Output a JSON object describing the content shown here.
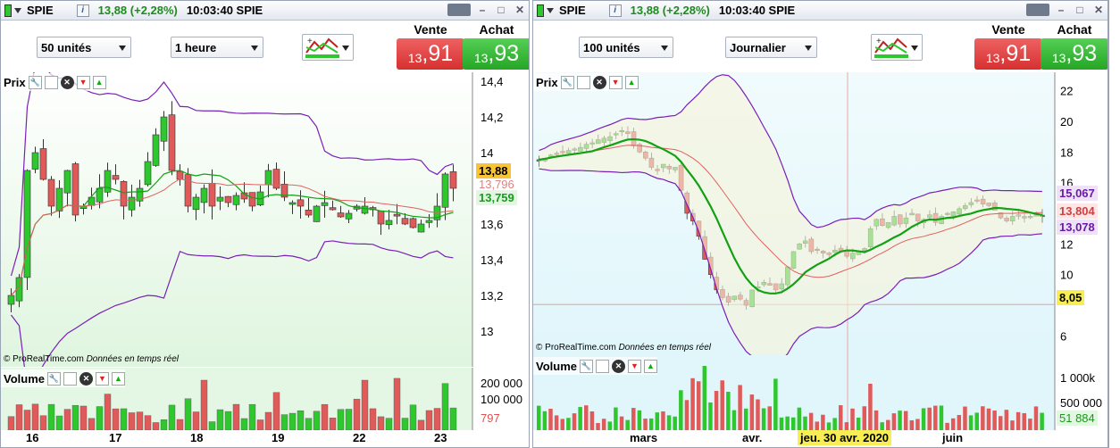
{
  "left": {
    "title": {
      "symbol": "SPIE",
      "change": "13,88 (+2,28%)",
      "time": "10:03:40 SPIE"
    },
    "units": "50 unités",
    "period": "1 heure",
    "sell": {
      "label": "Vente",
      "prefix": "13",
      "price": ",91"
    },
    "buy": {
      "label": "Achat",
      "prefix": "13",
      "price": ",93"
    },
    "price_panel": {
      "label": "Prix"
    },
    "volume_panel": {
      "label": "Volume"
    },
    "copyright": "© ProRealTime.com",
    "copyright_note": "Données en temps réel",
    "y_ticks": [
      "14,4",
      "14,2",
      "14",
      "13,6",
      "13,4",
      "13,2",
      "13"
    ],
    "price_tags": {
      "last": "13,88",
      "ma1": "13,796",
      "ma2": "13,759"
    },
    "vol_ticks": [
      "200 000",
      "100 000"
    ],
    "vol_last": "797",
    "x_dates": [
      "16",
      "17",
      "18",
      "19",
      "22",
      "23"
    ]
  },
  "right": {
    "title": {
      "symbol": "SPIE",
      "change": "13,88 (+2,28%)",
      "time": "10:03:40 SPIE"
    },
    "units": "100 unités",
    "period": "Journalier",
    "sell": {
      "label": "Vente",
      "prefix": "13",
      "price": ",91"
    },
    "buy": {
      "label": "Achat",
      "prefix": "13",
      "price": ",93"
    },
    "price_panel": {
      "label": "Prix"
    },
    "volume_panel": {
      "label": "Volume"
    },
    "copyright": "© ProRealTime.com",
    "copyright_note": "Données en temps réel",
    "y_ticks": [
      "22",
      "20",
      "18",
      "16",
      "12",
      "10",
      "6"
    ],
    "price_tags": {
      "upper": "15,067",
      "ma": "13,804",
      "lower": "13,078",
      "cursor": "8,05"
    },
    "vol_ticks": [
      "1 000k",
      "500 000"
    ],
    "vol_last": "51 884",
    "x_dates": [
      "mars",
      "avr.",
      "juin"
    ],
    "cursor_date": "jeu. 30 avr. 2020"
  },
  "colors": {
    "up": "#2ec82e",
    "down": "#e05a5a",
    "band": "#7a1fb8",
    "ma_green": "#14a014",
    "ma_red": "#e06060"
  },
  "chart_data": [
    {
      "type": "candlestick",
      "title": "SPIE 1 heure",
      "categories": [
        "16",
        "17",
        "18",
        "19",
        "22",
        "23"
      ],
      "ylim": [
        12.8,
        14.45
      ],
      "last": 13.88
    },
    {
      "type": "candlestick",
      "title": "SPIE Journalier",
      "categories": [
        "mars",
        "avr.",
        "juin"
      ],
      "ylim": [
        4.8,
        23
      ],
      "last": 13.88
    }
  ]
}
